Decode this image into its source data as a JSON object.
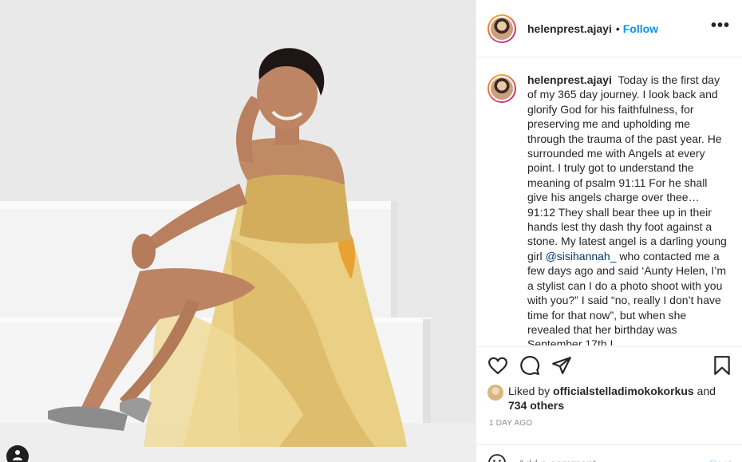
{
  "post": {
    "username": "helenprest.ajayi",
    "follow_label": "Follow",
    "more_label": "•••",
    "caption_user": "helenprest.ajayi",
    "caption_text_before": "Today is the first day of my 365 day journey. I look back and glorify God for his faithfulness, for preserving me and upholding me through the trauma of the past year. He surrounded me with Angels at every point. I truly got to understand the meaning of psalm 91:11 For he shall give his angels charge over thee… 91:12 They shall bear thee up in their hands lest thy dash thy foot against a stone. My latest angel is a darling young girl",
    "caption_mention": "@sisihannah_",
    "caption_text_after": "who contacted me a few days ago and said ‘Aunty Helen, I’m a stylist can I do a photo shoot with you with you?” I said “no, really I don’t have time for that now”, but when she revealed that her birthday was September 17th I",
    "liked_by_prefix": "Liked by",
    "liked_by_user": "officialstelladimokokorkus",
    "liked_by_and": "and",
    "liked_by_others": "734 others",
    "timestamp": "1 DAY AGO",
    "comment_placeholder": "Add a comment…",
    "post_label": "Post"
  },
  "icons": {
    "like": "heart-icon",
    "comment": "comment-icon",
    "share": "paper-plane-icon",
    "save": "bookmark-icon",
    "emoji": "smiley-icon",
    "tag": "user-tag-icon"
  },
  "colors": {
    "link_blue": "#0095f6",
    "post_disabled": "#b2dffc",
    "mention": "#00376b",
    "muted": "#8e8e8e",
    "text": "#262626"
  }
}
